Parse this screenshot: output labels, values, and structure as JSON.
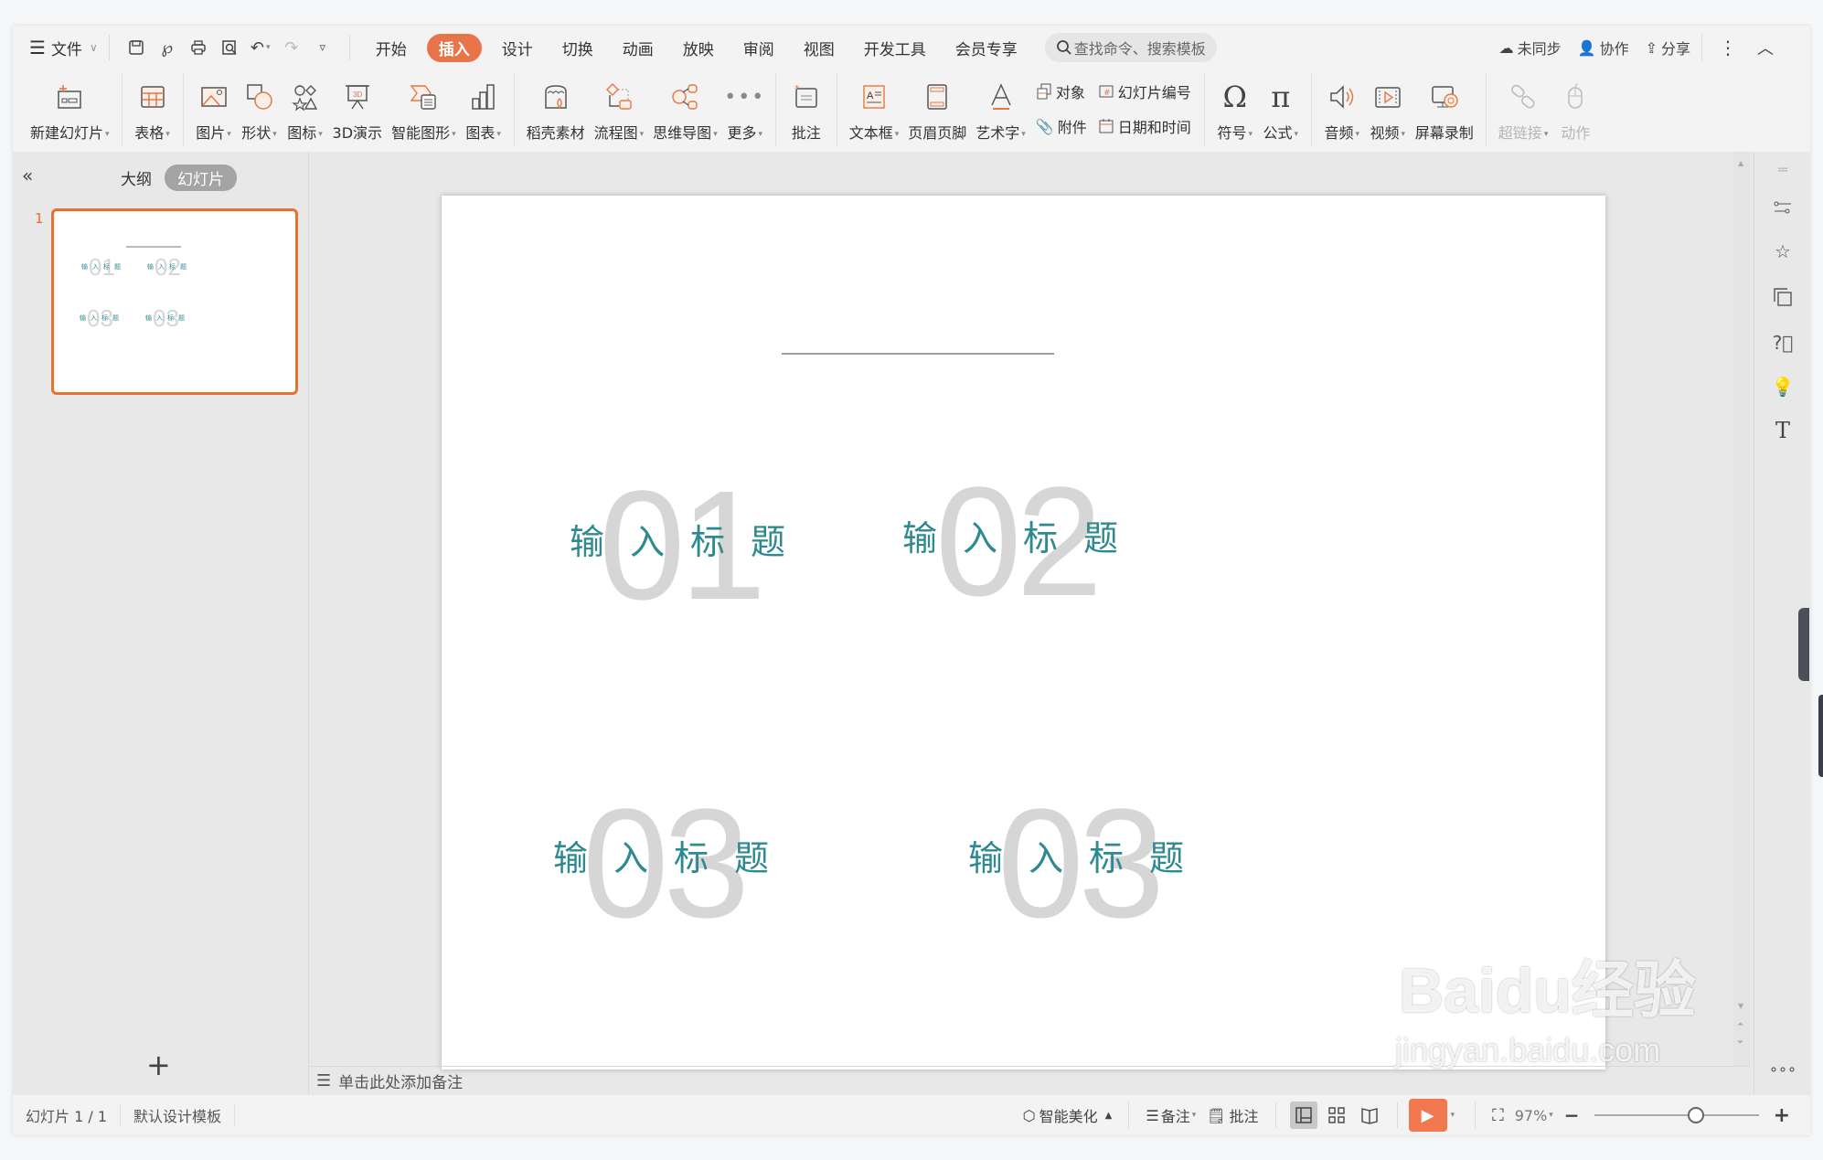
{
  "menu": {
    "file_label": "文件"
  },
  "tabs": [
    {
      "label": "开始",
      "active": false
    },
    {
      "label": "插入",
      "active": true
    },
    {
      "label": "设计",
      "active": false
    },
    {
      "label": "切换",
      "active": false
    },
    {
      "label": "动画",
      "active": false
    },
    {
      "label": "放映",
      "active": false
    },
    {
      "label": "审阅",
      "active": false
    },
    {
      "label": "视图",
      "active": false
    },
    {
      "label": "开发工具",
      "active": false
    },
    {
      "label": "会员专享",
      "active": false
    }
  ],
  "search": {
    "placeholder": "查找命令、搜索模板"
  },
  "top_right": {
    "sync": "未同步",
    "collab": "协作",
    "share": "分享"
  },
  "ribbon": {
    "new_slide": "新建幻灯片",
    "table": "表格",
    "picture": "图片",
    "shape": "形状",
    "icon": "图标",
    "demo3d": "3D演示",
    "smartart": "智能图形",
    "chart": "图表",
    "material": "稻壳素材",
    "flowchart": "流程图",
    "mindmap": "思维导图",
    "more": "更多",
    "comment": "批注",
    "textbox": "文本框",
    "header_footer": "页眉页脚",
    "wordart": "艺术字",
    "object": "对象",
    "slide_number": "幻灯片编号",
    "attachment": "附件",
    "datetime": "日期和时间",
    "symbol": "符号",
    "formula": "公式",
    "audio": "音频",
    "video": "视频",
    "screen_record": "屏幕录制",
    "hyperlink": "超链接",
    "action": "动作"
  },
  "left_panel": {
    "outline_tab": "大纲",
    "slides_tab": "幻灯片",
    "thumb_number": "1"
  },
  "slide": {
    "blocks": [
      {
        "number": "01",
        "title": "输入标题"
      },
      {
        "number": "02",
        "title": "输入标题"
      },
      {
        "number": "03",
        "title": "输入标题"
      },
      {
        "number": "03",
        "title": "输入标题"
      }
    ]
  },
  "notes": {
    "placeholder": "单击此处添加备注"
  },
  "status": {
    "slide_count": "幻灯片 1 / 1",
    "template": "默认设计模板",
    "beautify": "智能美化",
    "notes": "备注",
    "comments": "批注",
    "zoom": "97%",
    "zoom_fraction": 0.62
  },
  "watermark": {
    "brand": "Baidu经验",
    "url": "jingyan.baidu.com"
  },
  "colors": {
    "accent": "#e8744a",
    "title_text": "#2d8a90",
    "number_text": "#d6d6d6"
  }
}
